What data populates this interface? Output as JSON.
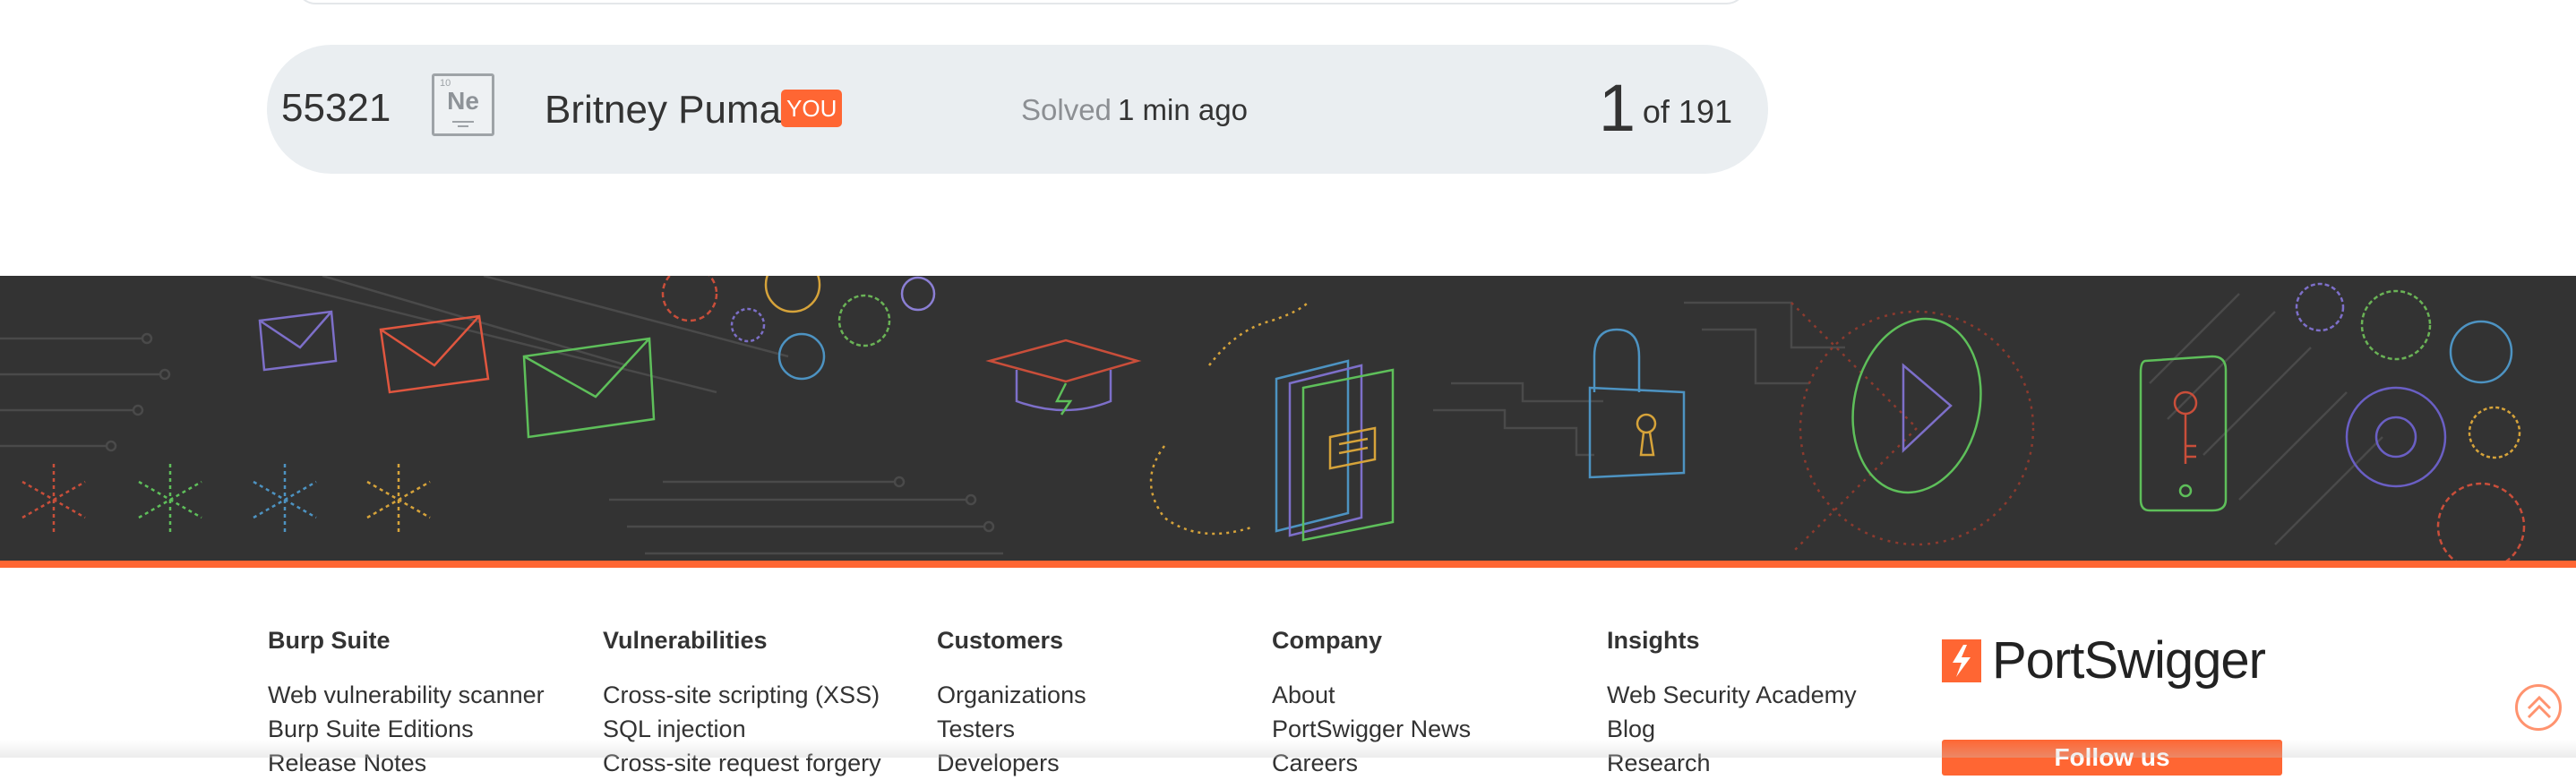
{
  "leaderboard_row": {
    "rank": "55321",
    "avatar": {
      "atomic_number": "10",
      "element_symbol": "Ne"
    },
    "player_name": "Britney Puma",
    "you_badge": "YOU",
    "solved_label": "Solved",
    "solved_time": "1 min ago",
    "position": "1",
    "position_of": "of 191"
  },
  "banner": {
    "icons": [
      "envelope-icon",
      "gear-icon",
      "graduation-cap-icon",
      "book-icon",
      "padlock-icon",
      "play-icon",
      "phone-icon",
      "asterisk-icon"
    ]
  },
  "footer": {
    "columns": [
      {
        "heading": "Burp Suite",
        "links": [
          "Web vulnerability scanner",
          "Burp Suite Editions",
          "Release Notes"
        ]
      },
      {
        "heading": "Vulnerabilities",
        "links": [
          "Cross-site scripting (XSS)",
          "SQL injection",
          "Cross-site request forgery"
        ]
      },
      {
        "heading": "Customers",
        "links": [
          "Organizations",
          "Testers",
          "Developers"
        ]
      },
      {
        "heading": "Company",
        "links": [
          "About",
          "PortSwigger News",
          "Careers"
        ]
      },
      {
        "heading": "Insights",
        "links": [
          "Web Security Academy",
          "Blog",
          "Research"
        ]
      }
    ],
    "logo_text": "PortSwigger",
    "follow_label": "Follow us"
  },
  "colors": {
    "accent": "#ff6633",
    "banner_bg": "#333333",
    "row_bg": "#eaeef1"
  }
}
